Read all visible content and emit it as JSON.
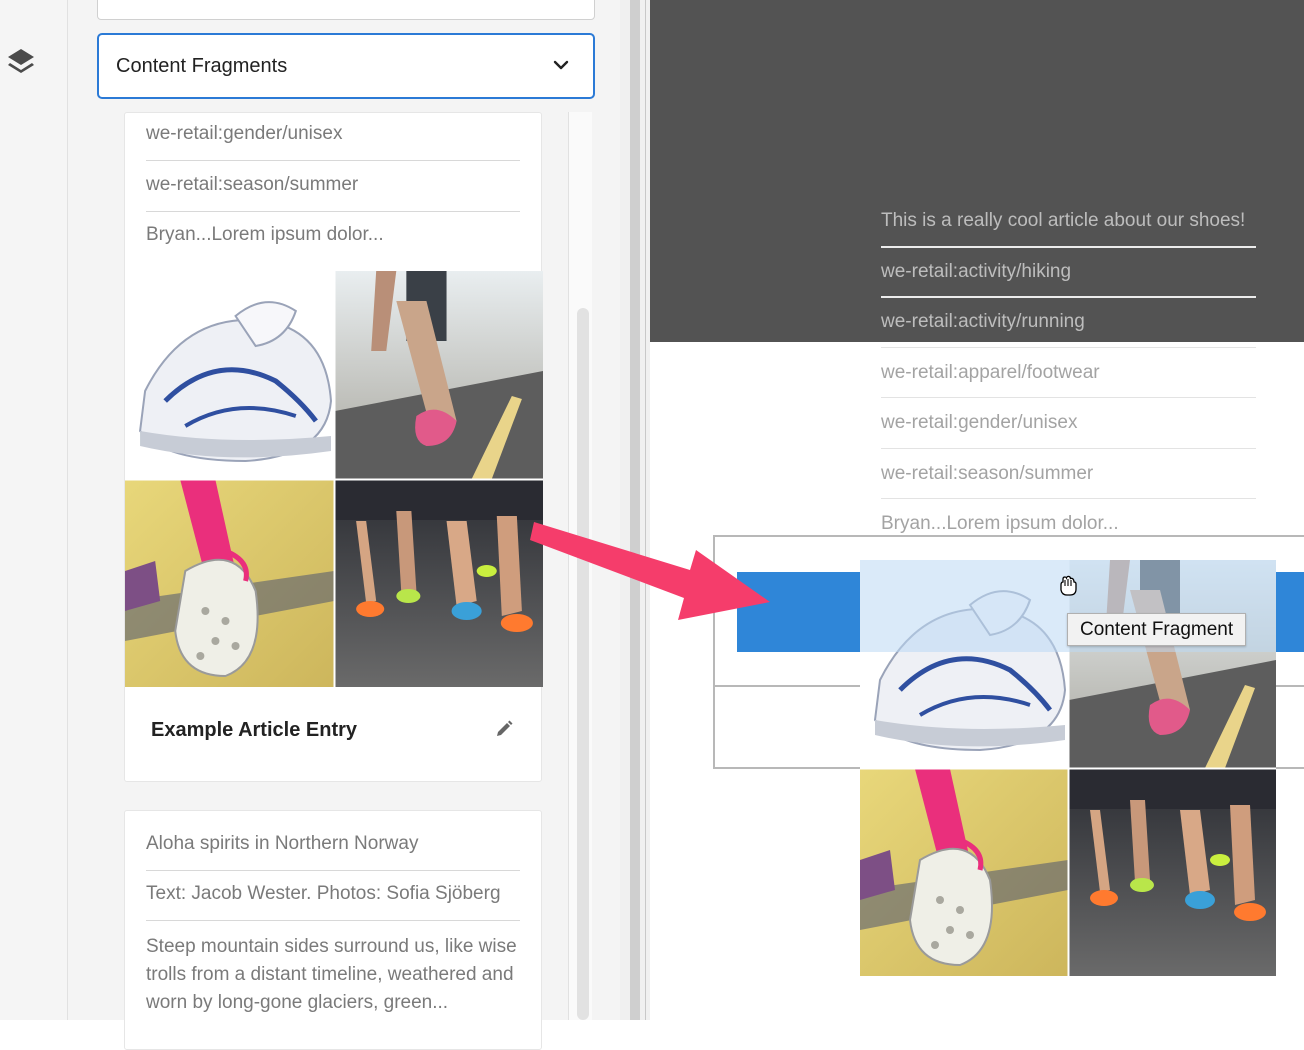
{
  "sidebar": {
    "layers_icon": "layers-icon"
  },
  "panel": {
    "filter_select": {
      "value": "Content Fragments",
      "icon": "chevron-down-icon"
    },
    "cards": [
      {
        "meta": [
          "we-retail:gender/unisex",
          "we-retail:season/summer",
          "Bryan...Lorem ipsum dolor..."
        ],
        "thumbnails": [
          "sneaker-thumbnail",
          "runner-legs-thumbnail",
          "shoe-sole-thumbnail",
          "marathon-runners-thumbnail"
        ],
        "title": "Example Article Entry",
        "edit_icon": "pencil-icon"
      },
      {
        "meta": [
          "Aloha spirits in Northern Norway",
          "Text: Jacob Wester. Photos: Sofia Sjöberg",
          "Steep mountain sides surround us, like wise trolls from a distant timeline, weathered and worn by long-gone glaciers, green..."
        ]
      }
    ]
  },
  "page": {
    "hero_lines": [
      "This is a really cool article about our shoes!",
      "we-retail:activity/hiking",
      "we-retail:activity/running"
    ],
    "lines": [
      "we-retail:apparel/footwear",
      "we-retail:gender/unisex",
      "we-retail:season/summer",
      "Bryan...Lorem ipsum dolor..."
    ],
    "drag_tooltip": "Content Fragment",
    "cursor_icon": "grab-hand-icon",
    "arrow_icon": "arrow-right-icon"
  },
  "colors": {
    "accent": "#2b7ad6",
    "drop_target": "#2f86d8",
    "arrow": "#f53d6b",
    "hero_bg": "#535353"
  }
}
